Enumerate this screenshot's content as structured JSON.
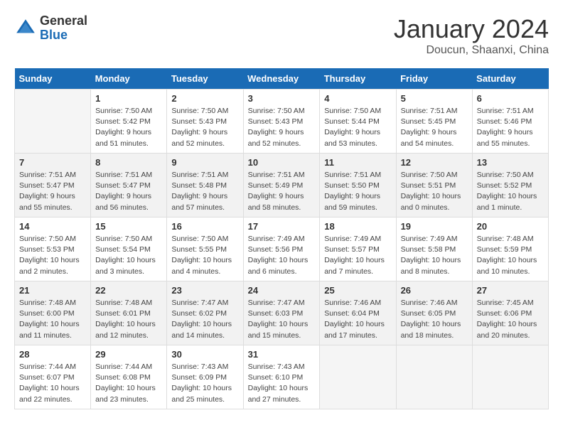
{
  "header": {
    "logo_general": "General",
    "logo_blue": "Blue",
    "title": "January 2024",
    "subtitle": "Doucun, Shaanxi, China"
  },
  "calendar": {
    "days_of_week": [
      "Sunday",
      "Monday",
      "Tuesday",
      "Wednesday",
      "Thursday",
      "Friday",
      "Saturday"
    ],
    "weeks": [
      [
        {
          "day": "",
          "info": ""
        },
        {
          "day": "1",
          "info": "Sunrise: 7:50 AM\nSunset: 5:42 PM\nDaylight: 9 hours\nand 51 minutes."
        },
        {
          "day": "2",
          "info": "Sunrise: 7:50 AM\nSunset: 5:43 PM\nDaylight: 9 hours\nand 52 minutes."
        },
        {
          "day": "3",
          "info": "Sunrise: 7:50 AM\nSunset: 5:43 PM\nDaylight: 9 hours\nand 52 minutes."
        },
        {
          "day": "4",
          "info": "Sunrise: 7:50 AM\nSunset: 5:44 PM\nDaylight: 9 hours\nand 53 minutes."
        },
        {
          "day": "5",
          "info": "Sunrise: 7:51 AM\nSunset: 5:45 PM\nDaylight: 9 hours\nand 54 minutes."
        },
        {
          "day": "6",
          "info": "Sunrise: 7:51 AM\nSunset: 5:46 PM\nDaylight: 9 hours\nand 55 minutes."
        }
      ],
      [
        {
          "day": "7",
          "info": "Sunrise: 7:51 AM\nSunset: 5:47 PM\nDaylight: 9 hours\nand 55 minutes."
        },
        {
          "day": "8",
          "info": "Sunrise: 7:51 AM\nSunset: 5:47 PM\nDaylight: 9 hours\nand 56 minutes."
        },
        {
          "day": "9",
          "info": "Sunrise: 7:51 AM\nSunset: 5:48 PM\nDaylight: 9 hours\nand 57 minutes."
        },
        {
          "day": "10",
          "info": "Sunrise: 7:51 AM\nSunset: 5:49 PM\nDaylight: 9 hours\nand 58 minutes."
        },
        {
          "day": "11",
          "info": "Sunrise: 7:51 AM\nSunset: 5:50 PM\nDaylight: 9 hours\nand 59 minutes."
        },
        {
          "day": "12",
          "info": "Sunrise: 7:50 AM\nSunset: 5:51 PM\nDaylight: 10 hours\nand 0 minutes."
        },
        {
          "day": "13",
          "info": "Sunrise: 7:50 AM\nSunset: 5:52 PM\nDaylight: 10 hours\nand 1 minute."
        }
      ],
      [
        {
          "day": "14",
          "info": "Sunrise: 7:50 AM\nSunset: 5:53 PM\nDaylight: 10 hours\nand 2 minutes."
        },
        {
          "day": "15",
          "info": "Sunrise: 7:50 AM\nSunset: 5:54 PM\nDaylight: 10 hours\nand 3 minutes."
        },
        {
          "day": "16",
          "info": "Sunrise: 7:50 AM\nSunset: 5:55 PM\nDaylight: 10 hours\nand 4 minutes."
        },
        {
          "day": "17",
          "info": "Sunrise: 7:49 AM\nSunset: 5:56 PM\nDaylight: 10 hours\nand 6 minutes."
        },
        {
          "day": "18",
          "info": "Sunrise: 7:49 AM\nSunset: 5:57 PM\nDaylight: 10 hours\nand 7 minutes."
        },
        {
          "day": "19",
          "info": "Sunrise: 7:49 AM\nSunset: 5:58 PM\nDaylight: 10 hours\nand 8 minutes."
        },
        {
          "day": "20",
          "info": "Sunrise: 7:48 AM\nSunset: 5:59 PM\nDaylight: 10 hours\nand 10 minutes."
        }
      ],
      [
        {
          "day": "21",
          "info": "Sunrise: 7:48 AM\nSunset: 6:00 PM\nDaylight: 10 hours\nand 11 minutes."
        },
        {
          "day": "22",
          "info": "Sunrise: 7:48 AM\nSunset: 6:01 PM\nDaylight: 10 hours\nand 12 minutes."
        },
        {
          "day": "23",
          "info": "Sunrise: 7:47 AM\nSunset: 6:02 PM\nDaylight: 10 hours\nand 14 minutes."
        },
        {
          "day": "24",
          "info": "Sunrise: 7:47 AM\nSunset: 6:03 PM\nDaylight: 10 hours\nand 15 minutes."
        },
        {
          "day": "25",
          "info": "Sunrise: 7:46 AM\nSunset: 6:04 PM\nDaylight: 10 hours\nand 17 minutes."
        },
        {
          "day": "26",
          "info": "Sunrise: 7:46 AM\nSunset: 6:05 PM\nDaylight: 10 hours\nand 18 minutes."
        },
        {
          "day": "27",
          "info": "Sunrise: 7:45 AM\nSunset: 6:06 PM\nDaylight: 10 hours\nand 20 minutes."
        }
      ],
      [
        {
          "day": "28",
          "info": "Sunrise: 7:44 AM\nSunset: 6:07 PM\nDaylight: 10 hours\nand 22 minutes."
        },
        {
          "day": "29",
          "info": "Sunrise: 7:44 AM\nSunset: 6:08 PM\nDaylight: 10 hours\nand 23 minutes."
        },
        {
          "day": "30",
          "info": "Sunrise: 7:43 AM\nSunset: 6:09 PM\nDaylight: 10 hours\nand 25 minutes."
        },
        {
          "day": "31",
          "info": "Sunrise: 7:43 AM\nSunset: 6:10 PM\nDaylight: 10 hours\nand 27 minutes."
        },
        {
          "day": "",
          "info": ""
        },
        {
          "day": "",
          "info": ""
        },
        {
          "day": "",
          "info": ""
        }
      ]
    ]
  }
}
